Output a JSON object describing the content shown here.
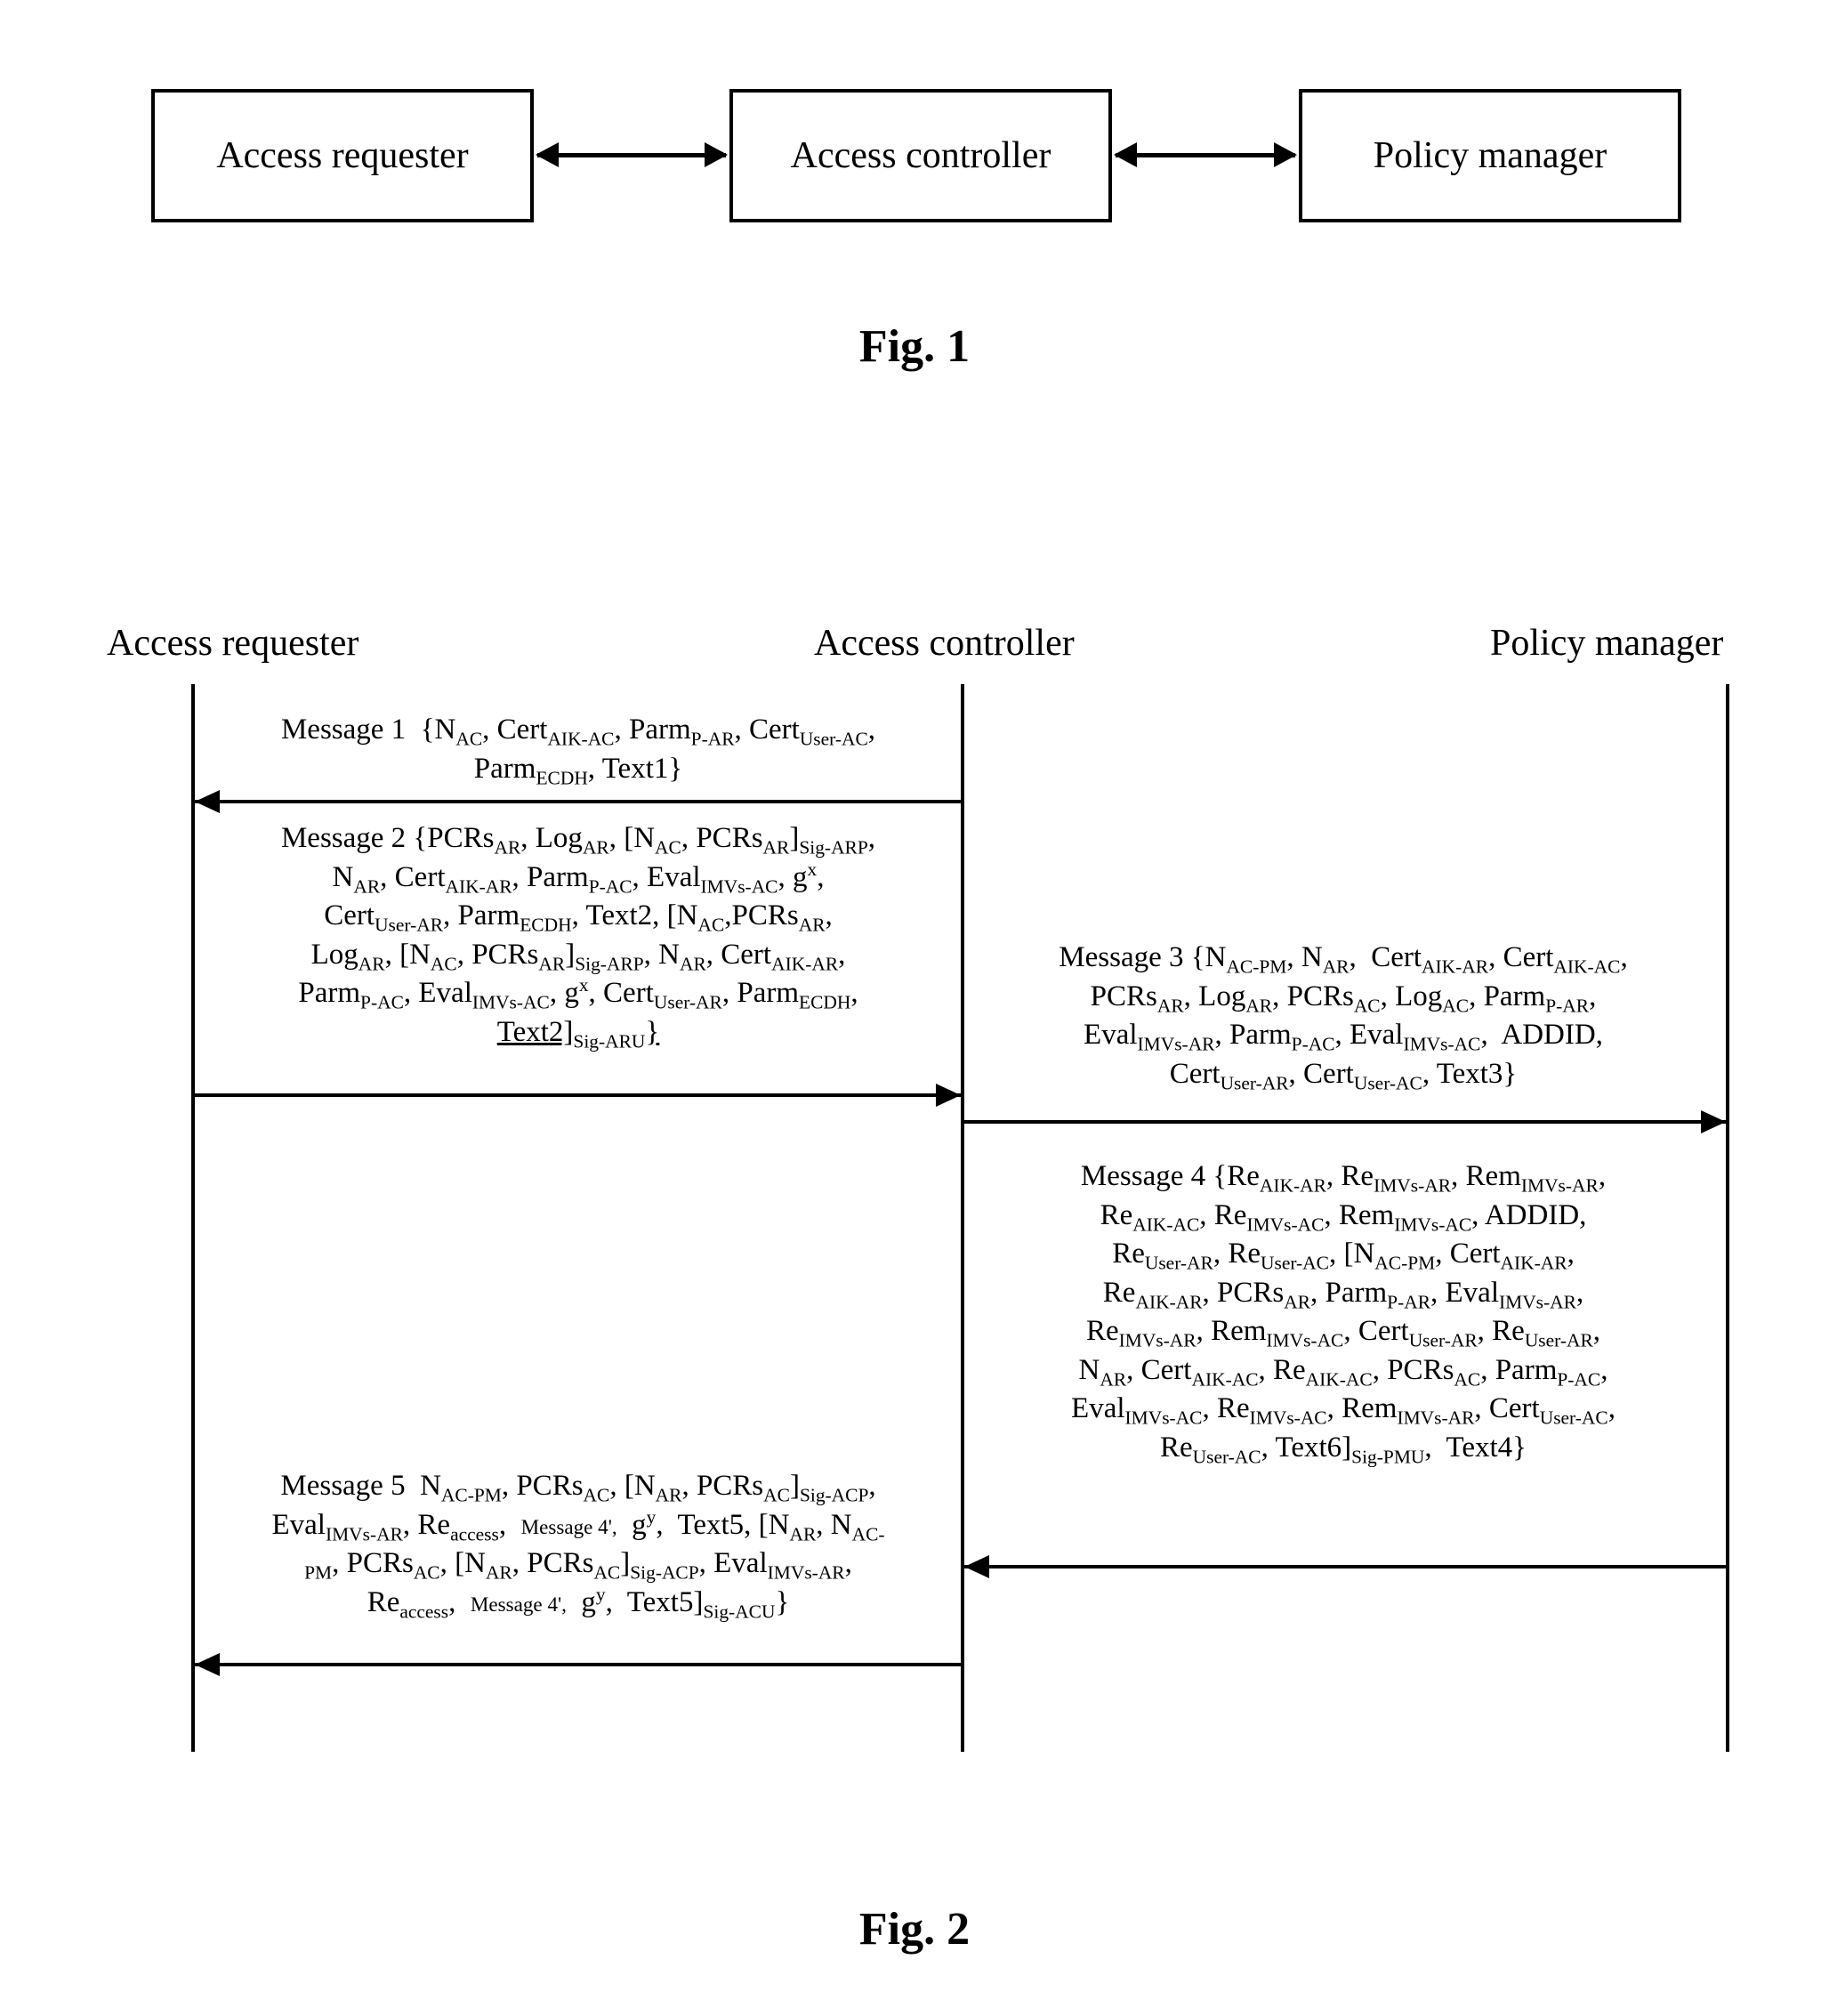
{
  "fig1": {
    "caption": "Fig. 1",
    "boxes": {
      "requester": "Access requester",
      "controller": "Access controller",
      "policy": "Policy manager"
    }
  },
  "fig2": {
    "caption": "Fig. 2",
    "lifelines": {
      "requester": "Access requester",
      "controller": "Access controller",
      "policy": "Policy manager"
    },
    "messages": {
      "m1": {
        "index": 1,
        "from": "controller",
        "to": "requester",
        "label": "Message 1",
        "payload": "{N_AC, Cert_AIK-AC, Parm_P-AR, Cert_User-AC, Parm_ECDH, Text1}"
      },
      "m2": {
        "index": 2,
        "from": "requester",
        "to": "controller",
        "label": "Message 2",
        "payload": "{PCRs_AR, Log_AR, [N_AC, PCRs_AR]_Sig-ARP, N_AR, Cert_AIK-AR, Parm_P-AC, Eval_IMVs-AC, g^x, Cert_User-AR, Parm_ECDH, Text2, [N_AC, PCRs_AR, Log_AR, [N_AC, PCRs_AR]_Sig-ARP, N_AR, Cert_AIK-AR, Parm_P-AC, Eval_IMVs-AC, g^x, Cert_User-AR, Parm_ECDH, Text2]_Sig-ARU}"
      },
      "m3": {
        "index": 3,
        "from": "controller",
        "to": "policy",
        "label": "Message 3",
        "payload": "{N_AC-PM, N_AR, Cert_AIK-AR, Cert_AIK-AC, PCRs_AR, Log_AR, PCRs_AC, Log_AC, Parm_P-AR, Eval_IMVs-AR, Parm_P-AC, Eval_IMVs-AC, ADDID, Cert_User-AR, Cert_User-AC, Text3}"
      },
      "m4": {
        "index": 4,
        "from": "policy",
        "to": "controller",
        "label": "Message 4",
        "payload": "{Re_AIK-AR, Re_IMVs-AR, Rem_IMVs-AR, Re_AIK-AC, Re_IMVs-AC, Rem_IMVs-AC, ADDID, Re_User-AR, Re_User-AC, [N_AC-PM, Cert_AIK-AR, Re_AIK-AR, PCRs_AR, Parm_P-AR, Eval_IMVs-AR, Re_IMVs-AR, Rem_IMVs-AC, Cert_User-AR, Re_User-AR, N_AR, Cert_AIK-AC, Re_AIK-AC, PCRs_AC, Parm_P-AC, Eval_IMVs-AC, Re_IMVs-AC, Rem_IMVs-AR, Cert_User-AC, Re_User-AC, Text6]_Sig-PMU, Text4}"
      },
      "m5": {
        "index": 5,
        "from": "controller",
        "to": "requester",
        "label": "Message 5",
        "payload": "N_AC-PM, PCRs_AC, [N_AR, PCRs_AC]_Sig-ACP, Eval_IMVs-AR, Re_access, Message 4', g^y, Text5, [N_AR, N_AC-PM, PCRs_AC, [N_AR, PCRs_AC]_Sig-ACP, Eval_IMVs-AR, Re_access, Message 4', g^y, Text5]_Sig-ACU}"
      }
    }
  },
  "chart_data": {
    "type": "table",
    "figure1": {
      "nodes": [
        "Access requester",
        "Access controller",
        "Policy manager"
      ],
      "edges": [
        {
          "between": [
            "Access requester",
            "Access controller"
          ],
          "direction": "bidirectional"
        },
        {
          "between": [
            "Access controller",
            "Policy manager"
          ],
          "direction": "bidirectional"
        }
      ]
    },
    "figure2": {
      "lifelines": [
        "Access requester",
        "Access controller",
        "Policy manager"
      ],
      "sequence": [
        {
          "index": 1,
          "from": "Access controller",
          "to": "Access requester",
          "fields": [
            "N_AC",
            "Cert_AIK-AC",
            "Parm_P-AR",
            "Cert_User-AC",
            "Parm_ECDH",
            "Text1"
          ]
        },
        {
          "index": 2,
          "from": "Access requester",
          "to": "Access controller",
          "fields": [
            "PCRs_AR",
            "Log_AR",
            "[N_AC, PCRs_AR]_Sig-ARP",
            "N_AR",
            "Cert_AIK-AR",
            "Parm_P-AC",
            "Eval_IMVs-AC",
            "g^x",
            "Cert_User-AR",
            "Parm_ECDH",
            "Text2",
            "[N_AC, PCRs_AR, Log_AR, [N_AC, PCRs_AR]_Sig-ARP, N_AR, Cert_AIK-AR, Parm_P-AC, Eval_IMVs-AC, g^x, Cert_User-AR, Parm_ECDH, Text2]_Sig-ARU"
          ]
        },
        {
          "index": 3,
          "from": "Access controller",
          "to": "Policy manager",
          "fields": [
            "N_AC-PM",
            "N_AR",
            "Cert_AIK-AR",
            "Cert_AIK-AC",
            "PCRs_AR",
            "Log_AR",
            "PCRs_AC",
            "Log_AC",
            "Parm_P-AR",
            "Eval_IMVs-AR",
            "Parm_P-AC",
            "Eval_IMVs-AC",
            "ADDID",
            "Cert_User-AR",
            "Cert_User-AC",
            "Text3"
          ]
        },
        {
          "index": 4,
          "from": "Policy manager",
          "to": "Access controller",
          "fields": [
            "Re_AIK-AR",
            "Re_IMVs-AR",
            "Rem_IMVs-AR",
            "Re_AIK-AC",
            "Re_IMVs-AC",
            "Rem_IMVs-AC",
            "ADDID",
            "Re_User-AR",
            "Re_User-AC",
            "[N_AC-PM, Cert_AIK-AR, Re_AIK-AR, PCRs_AR, Parm_P-AR, Eval_IMVs-AR, Re_IMVs-AR, Rem_IMVs-AC, Cert_User-AR, Re_User-AR, N_AR, Cert_AIK-AC, Re_AIK-AC, PCRs_AC, Parm_P-AC, Eval_IMVs-AC, Re_IMVs-AC, Rem_IMVs-AR, Cert_User-AC, Re_User-AC, Text6]_Sig-PMU",
            "Text4"
          ]
        },
        {
          "index": 5,
          "from": "Access controller",
          "to": "Access requester",
          "fields": [
            "N_AC-PM",
            "PCRs_AC",
            "[N_AR, PCRs_AC]_Sig-ACP",
            "Eval_IMVs-AR",
            "Re_access",
            "Message 4'",
            "g^y",
            "Text5",
            "[N_AR, N_AC-PM, PCRs_AC, [N_AR, PCRs_AC]_Sig-ACP, Eval_IMVs-AR, Re_access, Message 4', g^y, Text5]_Sig-ACU"
          ]
        }
      ]
    }
  }
}
